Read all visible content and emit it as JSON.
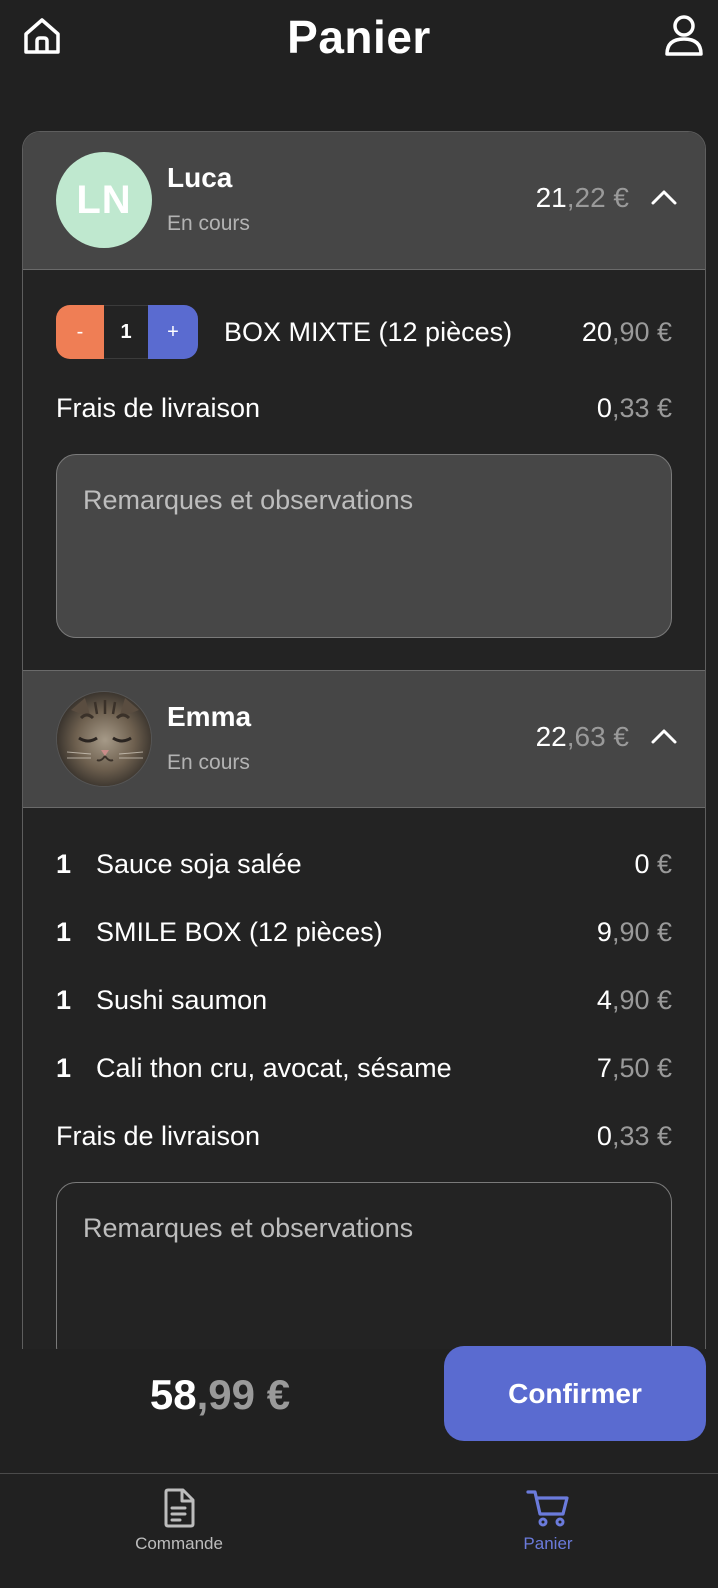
{
  "header": {
    "title": "Panier",
    "home_icon": "home-icon",
    "user_icon": "user-icon"
  },
  "orders": [
    {
      "initials": "LN",
      "name": "Luca",
      "status": "En cours",
      "total_int": "21",
      "total_dec": ",22 €",
      "item": {
        "quantity": "1",
        "minus": "-",
        "plus": "+",
        "label": "BOX MIXTE (12 pièces)",
        "price_int": "20",
        "price_dec": ",90 €"
      },
      "delivery": {
        "label": "Frais de livraison",
        "price_int": "0",
        "price_dec": ",33 €"
      },
      "remarks_placeholder": "Remarques et observations"
    },
    {
      "name": "Emma",
      "status": "En cours",
      "total_int": "22",
      "total_dec": ",63 €",
      "items": [
        {
          "qty": "1",
          "label": "Sauce soja salée",
          "price_int": "0",
          "price_dec": " €"
        },
        {
          "qty": "1",
          "label": "SMILE BOX (12 pièces)",
          "price_int": "9",
          "price_dec": ",90 €"
        },
        {
          "qty": "1",
          "label": "Sushi saumon",
          "price_int": "4",
          "price_dec": ",90 €"
        },
        {
          "qty": "1",
          "label": "Cali thon cru, avocat, sésame",
          "price_int": "7",
          "price_dec": ",50 €"
        }
      ],
      "delivery": {
        "label": "Frais de livraison",
        "price_int": "0",
        "price_dec": ",33 €"
      },
      "remarks_placeholder": "Remarques et observations"
    }
  ],
  "footer": {
    "total_int": "58",
    "total_dec": ",99 €",
    "confirm_label": "Confirmer"
  },
  "tabs": [
    {
      "label": "Commande",
      "icon": "document-icon",
      "active": false
    },
    {
      "label": "Panier",
      "icon": "cart-icon",
      "active": true
    }
  ],
  "colors": {
    "accent": "#5a6bd0",
    "minus": "#ef7e55",
    "avatar_bg": "#bfe8cf",
    "background": "#212121"
  }
}
